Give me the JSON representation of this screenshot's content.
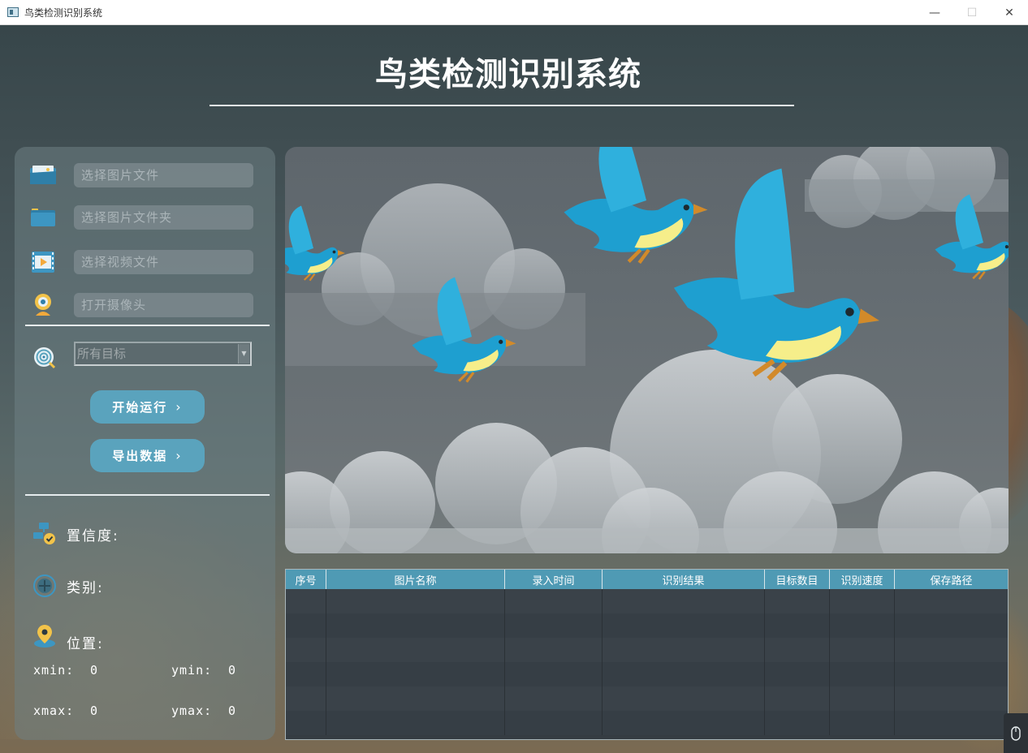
{
  "window": {
    "title": "鸟类检测识别系统",
    "minimize_glyph": "—",
    "maximize_glyph": "☐",
    "close_glyph": "✕"
  },
  "header": {
    "title": "鸟类检测识别系统"
  },
  "sidebar": {
    "inputs": [
      {
        "icon": "image-file-icon",
        "placeholder": "选择图片文件"
      },
      {
        "icon": "folder-icon",
        "placeholder": "选择图片文件夹"
      },
      {
        "icon": "video-file-icon",
        "placeholder": "选择视频文件"
      },
      {
        "icon": "camera-icon",
        "placeholder": "打开摄像头"
      }
    ],
    "target_select": {
      "icon": "target-icon",
      "value": "所有目标"
    },
    "start_button": {
      "label": "开始运行",
      "chevron": "›"
    },
    "export_button": {
      "label": "导出数据",
      "chevron": "›"
    },
    "confidence": {
      "icon": "confidence-icon",
      "label": "置信度:"
    },
    "category": {
      "icon": "category-icon",
      "label": "类别:"
    },
    "position": {
      "icon": "location-pin-icon",
      "label": "位置:"
    },
    "coords": {
      "xmin_label": "xmin:",
      "xmin": "0",
      "ymin_label": "ymin:",
      "ymin": "0",
      "xmax_label": "xmax:",
      "xmax": "0",
      "ymax_label": "ymax:",
      "ymax": "0"
    }
  },
  "display": {
    "image": "birds-in-clouds-illustration"
  },
  "table": {
    "columns": [
      "序号",
      "图片名称",
      "录入时间",
      "识别结果",
      "目标数目",
      "识别速度",
      "保存路径"
    ],
    "rows": []
  },
  "colors": {
    "accent": "#5aa3bd",
    "table_header": "#4f9ab4",
    "bird_blue": "#1e9fd0",
    "bird_yellow": "#f6ee8a"
  }
}
